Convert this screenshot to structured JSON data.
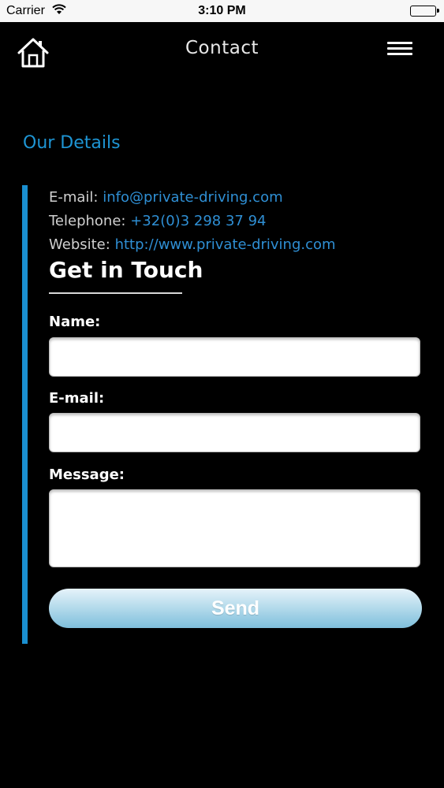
{
  "status_bar": {
    "carrier": "Carrier",
    "time": "3:10 PM"
  },
  "navbar": {
    "title": "Contact",
    "home_icon": "home-icon",
    "menu_icon": "hamburger-menu-icon"
  },
  "details": {
    "section_title": "Our Details",
    "email_label": "E-mail:",
    "email_value": "info@private-driving.com",
    "telephone_label": "Telephone:",
    "telephone_value": "+32(0)3 298 37 94",
    "website_label": "Website:",
    "website_value": "http://www.private-driving.com"
  },
  "form": {
    "heading": "Get in Touch",
    "name_label": "Name:",
    "name_value": "",
    "email_label": "E-mail:",
    "email_value": "",
    "message_label": "Message:",
    "message_value": "",
    "send_label": "Send"
  },
  "colors": {
    "accent": "#1e95d4",
    "link": "#2f8fd4",
    "background": "#000000"
  }
}
